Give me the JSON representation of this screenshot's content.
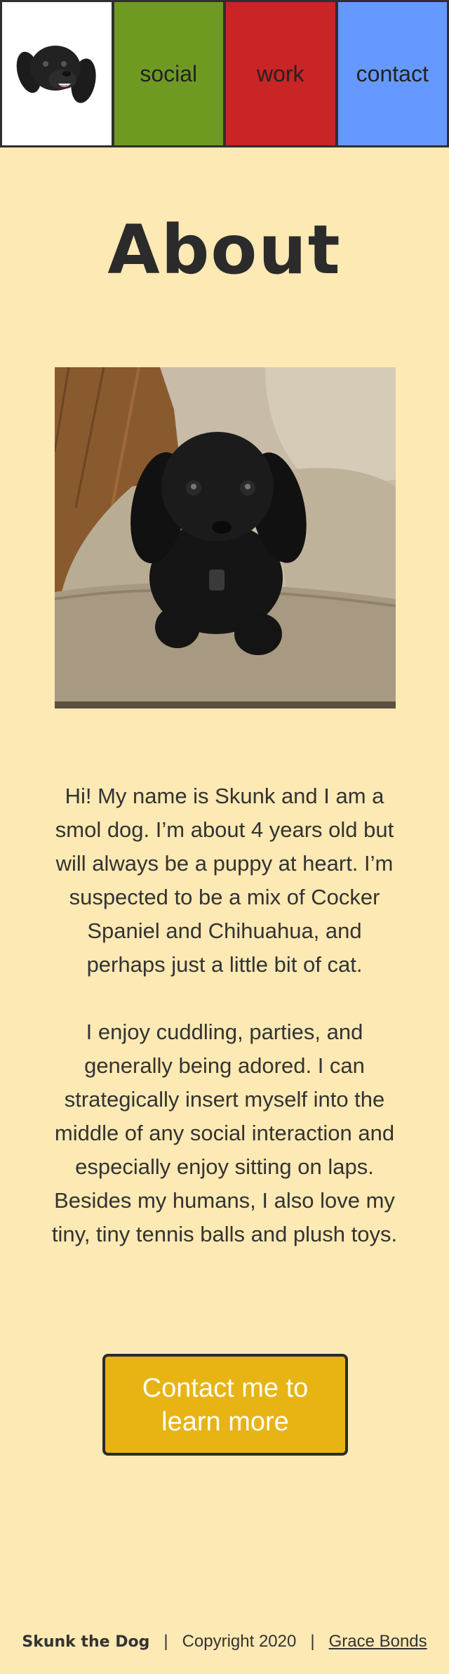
{
  "nav": {
    "logo_icon": "dog-head-logo",
    "items": [
      {
        "label": "social",
        "color": "#6f9a22"
      },
      {
        "label": "work",
        "color": "#c92426"
      },
      {
        "label": "contact",
        "color": "#6699ff"
      }
    ]
  },
  "page": {
    "title": "About",
    "photo_icon": "dog-photo"
  },
  "bio": {
    "paragraph_1": "Hi! My name is Skunk and I am a smol dog. I’m about 4 years old but will always be a puppy at heart. I’m suspected to be a mix of Cocker Spaniel and Chihuahua, and perhaps just a little bit of cat.",
    "paragraph_2": "I enjoy cuddling, parties, and generally being adored. I can strategically insert myself into the middle of any social interaction and especially enjoy sitting on laps. Besides my humans, I also love my tiny, tiny tennis balls and plush toys."
  },
  "cta": {
    "label": "Contact me to learn more",
    "color": "#e8b414"
  },
  "footer": {
    "brand": "Skunk the Dog",
    "separator": "|",
    "copyright": "Copyright 2020",
    "author_link": "Grace Bonds"
  },
  "colors": {
    "background": "#fde9b3",
    "text": "#2b2b2b"
  }
}
